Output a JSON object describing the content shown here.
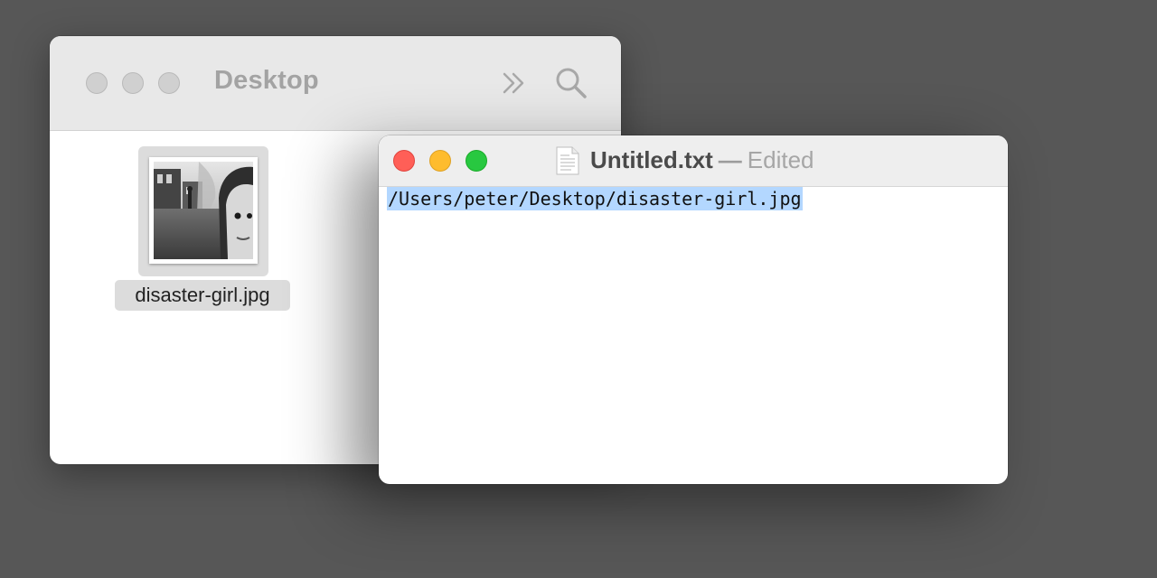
{
  "finder": {
    "title": "Desktop",
    "toolbar_icons": [
      "traffic-light-close-icon",
      "traffic-light-minimize-icon",
      "traffic-light-zoom-icon",
      "double-chevron-icon",
      "search-icon"
    ],
    "files": [
      {
        "name": "disaster-girl.jpg",
        "icon": "image-thumbnail-icon",
        "selected": true
      }
    ]
  },
  "textedit": {
    "filename": "Untitled.txt",
    "separator": "—",
    "status": "Edited",
    "icon": "text-document-icon",
    "content": "/Users/peter/Desktop/disaster-girl.jpg",
    "selection_color": "#b3d7ff"
  },
  "colors": {
    "desktop_bg": "#575757",
    "close": "#ff5f57",
    "minimize": "#febc2e",
    "zoom": "#28c840"
  }
}
